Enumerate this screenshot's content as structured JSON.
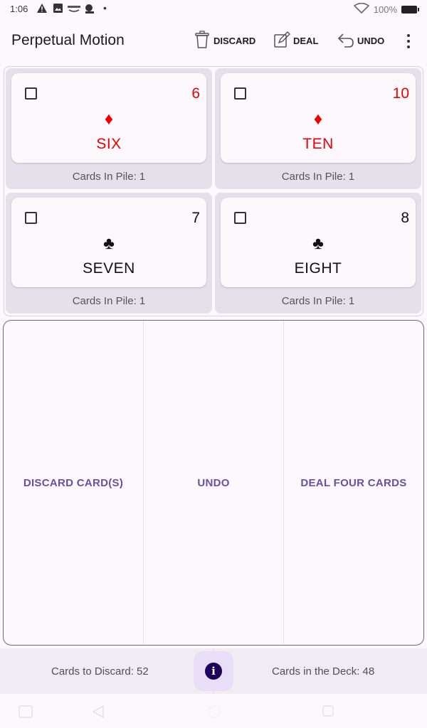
{
  "status_bar": {
    "time": "1:06",
    "battery": "100%"
  },
  "app_bar": {
    "title": "Perpetual Motion",
    "actions": [
      {
        "label": "DISCARD",
        "icon": "trash-icon"
      },
      {
        "label": "DEAL",
        "icon": "deal-icon"
      },
      {
        "label": "UNDO",
        "icon": "undo-icon"
      }
    ],
    "overflow_icon": "more-vert-icon"
  },
  "piles": [
    {
      "rank": "6",
      "suit": "♦",
      "suit_name": "diamonds",
      "name": "SIX",
      "color": "#ee0000",
      "checked": false,
      "count_text": "Cards In Pile: 1"
    },
    {
      "rank": "10",
      "suit": "♦",
      "suit_name": "diamonds",
      "name": "TEN",
      "color": "#ee0000",
      "checked": false,
      "count_text": "Cards In Pile: 1"
    },
    {
      "rank": "7",
      "suit": "♣",
      "suit_name": "clubs",
      "name": "SEVEN",
      "color": "#111111",
      "checked": false,
      "count_text": "Cards In Pile: 1"
    },
    {
      "rank": "8",
      "suit": "♣",
      "suit_name": "clubs",
      "name": "EIGHT",
      "color": "#111111",
      "checked": false,
      "count_text": "Cards In Pile: 1"
    }
  ],
  "buttons": {
    "discard": "DISCARD CARD(S)",
    "undo": "UNDO",
    "deal": "DEAL FOUR CARDS"
  },
  "info_bar": {
    "discard_label": "Cards to Discard: 52",
    "deck_label": "Cards in the Deck: 48",
    "info_icon": "info-icon",
    "info_glyph": "i"
  },
  "colors": {
    "accent": "#6750a4",
    "fab_bg": "#e8def8",
    "pile_bg": "#e5e0ea"
  }
}
